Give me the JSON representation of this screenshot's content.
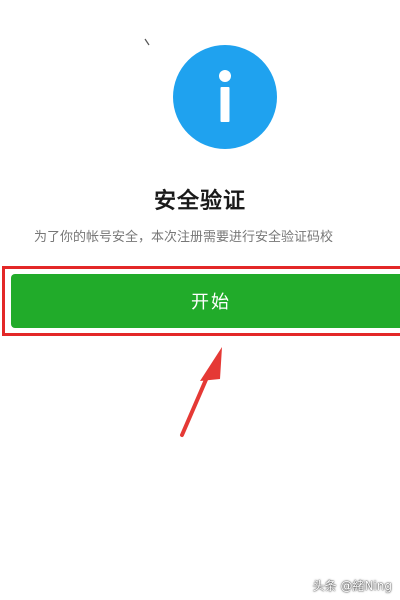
{
  "colors": {
    "info_blue": "#1fa2ef",
    "primary_green": "#21ab2a",
    "highlight_red": "#e32727",
    "arrow_red": "#e53935"
  },
  "icon": {
    "name": "info-icon"
  },
  "verification": {
    "title": "安全验证",
    "subtitle": "为了你的帐号安全，本次注册需要进行安全验证码校"
  },
  "actions": {
    "start_label": "开始"
  },
  "watermark": {
    "text": "头条 @緒Ning"
  }
}
